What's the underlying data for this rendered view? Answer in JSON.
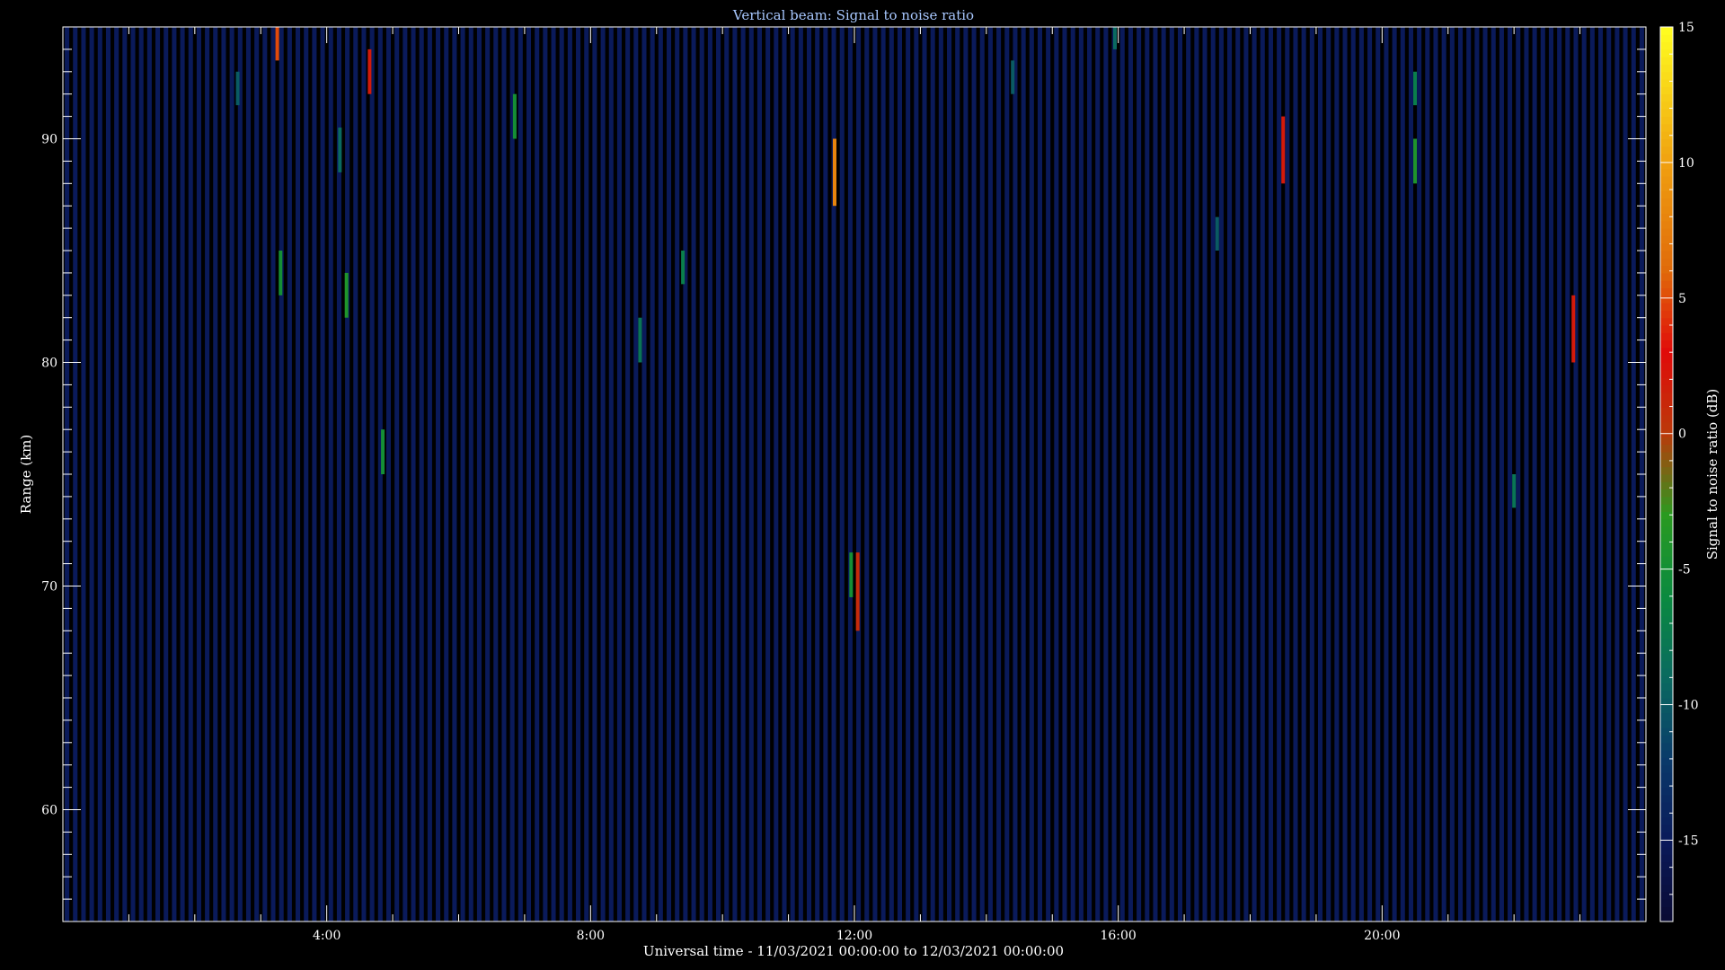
{
  "chart_data": {
    "type": "heatmap",
    "title": "Vertical beam: Signal to noise ratio",
    "xlabel": "Universal time - 11/03/2021 00:00:00 to 12/03/2021 00:00:00",
    "ylabel": "Range (km)",
    "colorbar_label": "Signal to noise ratio (dB)",
    "x_unit": "hours UT",
    "xlim": [
      0,
      24
    ],
    "ylim": [
      55,
      95
    ],
    "x_ticks": [
      {
        "value": 4,
        "label": "4:00"
      },
      {
        "value": 8,
        "label": "8:00"
      },
      {
        "value": 12,
        "label": "12:00"
      },
      {
        "value": 16,
        "label": "16:00"
      },
      {
        "value": 20,
        "label": "20:00"
      }
    ],
    "y_ticks": [
      {
        "value": 60,
        "label": "60"
      },
      {
        "value": 70,
        "label": "70"
      },
      {
        "value": 80,
        "label": "80"
      },
      {
        "value": 90,
        "label": "90"
      }
    ],
    "colorbar_range": [
      -18,
      15
    ],
    "colorbar_ticks": [
      {
        "value": 15,
        "label": "15"
      },
      {
        "value": 10,
        "label": "10"
      },
      {
        "value": 5,
        "label": "5"
      },
      {
        "value": 0,
        "label": "0"
      },
      {
        "value": -5,
        "label": "-5"
      },
      {
        "value": -10,
        "label": "-10"
      },
      {
        "value": -15,
        "label": "-15"
      }
    ],
    "colormap": [
      {
        "value": -18,
        "color": "#0a0a33"
      },
      {
        "value": -15,
        "color": "#0a1a5a"
      },
      {
        "value": -12,
        "color": "#0a3a6a"
      },
      {
        "value": -9,
        "color": "#0a6a60"
      },
      {
        "value": -6,
        "color": "#0a8a40"
      },
      {
        "value": -3,
        "color": "#2a9a20"
      },
      {
        "value": 0,
        "color": "#ba3a0a"
      },
      {
        "value": 3,
        "color": "#e00a0a"
      },
      {
        "value": 6,
        "color": "#e06a0a"
      },
      {
        "value": 10,
        "color": "#f0a010"
      },
      {
        "value": 15,
        "color": "#ffff20"
      }
    ],
    "background_snr_db": -15,
    "profile_spacing_hours": 0.125,
    "echoes": [
      {
        "time": 3.25,
        "range_top": 95.0,
        "range_bottom": 93.5,
        "snr": 5.0
      },
      {
        "time": 4.65,
        "range_top": 94.0,
        "range_bottom": 92.0,
        "snr": 2.0
      },
      {
        "time": 6.85,
        "range_top": 92.0,
        "range_bottom": 90.0,
        "snr": -5.0
      },
      {
        "time": 11.7,
        "range_top": 90.0,
        "range_bottom": 87.0,
        "snr": 8.0
      },
      {
        "time": 18.5,
        "range_top": 91.0,
        "range_bottom": 88.0,
        "snr": 2.0
      },
      {
        "time": 20.5,
        "range_top": 90.0,
        "range_bottom": 88.0,
        "snr": -4.0
      },
      {
        "time": 20.5,
        "range_top": 93.0,
        "range_bottom": 91.5,
        "snr": -7.0
      },
      {
        "time": 3.3,
        "range_top": 85.0,
        "range_bottom": 83.0,
        "snr": -5.0
      },
      {
        "time": 4.3,
        "range_top": 84.0,
        "range_bottom": 82.0,
        "snr": -4.0
      },
      {
        "time": 9.4,
        "range_top": 85.0,
        "range_bottom": 83.5,
        "snr": -7.0
      },
      {
        "time": 8.75,
        "range_top": 82.0,
        "range_bottom": 80.0,
        "snr": -8.0
      },
      {
        "time": 4.85,
        "range_top": 77.0,
        "range_bottom": 75.0,
        "snr": -5.0
      },
      {
        "time": 12.05,
        "range_top": 71.5,
        "range_bottom": 68.0,
        "snr": 1.0
      },
      {
        "time": 11.95,
        "range_top": 71.5,
        "range_bottom": 69.5,
        "snr": -5.0
      },
      {
        "time": 22.9,
        "range_top": 83.0,
        "range_bottom": 80.0,
        "snr": 2.0
      },
      {
        "time": 22.0,
        "range_top": 75.0,
        "range_bottom": 73.5,
        "snr": -8.0
      },
      {
        "time": 15.95,
        "range_top": 95.0,
        "range_bottom": 94.0,
        "snr": -9.0
      },
      {
        "time": 14.4,
        "range_top": 93.5,
        "range_bottom": 92.0,
        "snr": -10.0
      },
      {
        "time": 17.5,
        "range_top": 86.5,
        "range_bottom": 85.0,
        "snr": -10.0
      },
      {
        "time": 2.65,
        "range_top": 93.0,
        "range_bottom": 91.5,
        "snr": -10.0
      },
      {
        "time": 4.2,
        "range_top": 90.5,
        "range_bottom": 88.5,
        "snr": -9.0
      }
    ]
  }
}
